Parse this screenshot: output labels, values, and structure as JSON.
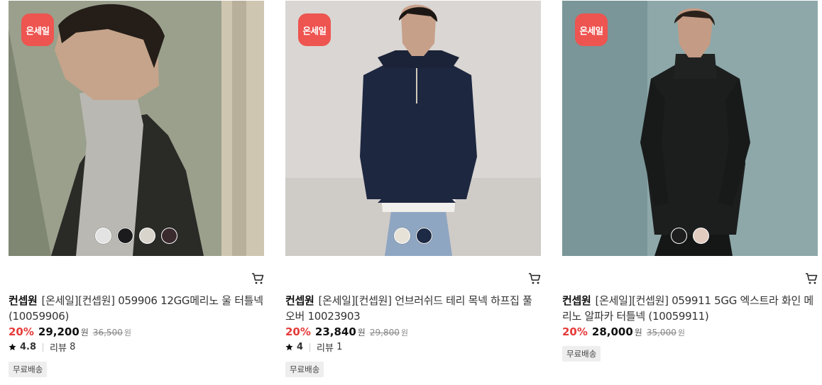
{
  "products": [
    {
      "badge": "온세일",
      "brand": "컨셉원",
      "name": "[온세일][컨셉원] 059906 12GG메리노 울 터틀넥 (10059906)",
      "discount": "20%",
      "price": "29,200",
      "price_unit": "원",
      "original_price": "36,500",
      "original_unit": "원",
      "rating": "4.8",
      "review_label": "리뷰",
      "review_count": "8",
      "tag": "무료배송",
      "swatch_colors": [
        "#e3e3e3",
        "#1b1b1d",
        "#d8d3cb",
        "#3a2a2e"
      ]
    },
    {
      "badge": "온세일",
      "brand": "컨셉원",
      "name": "[온세일][컨셉원] 언브러쉬드 테리 목넥 하프집 풀오버 10023903",
      "discount": "20%",
      "price": "23,840",
      "price_unit": "원",
      "original_price": "29,800",
      "original_unit": "원",
      "rating": "4",
      "review_label": "리뷰",
      "review_count": "1",
      "tag": "무료배송",
      "swatch_colors": [
        "#e6e2d8",
        "#1d2a45"
      ]
    },
    {
      "badge": "온세일",
      "brand": "컨셉원",
      "name": "[온세일][컨셉원] 059911 5GG 엑스트라 화인 메리노 알파카 터틀넥 (10059911)",
      "discount": "20%",
      "price": "28,000",
      "price_unit": "원",
      "original_price": "35,000",
      "original_unit": "원",
      "tag": "무료배송",
      "swatch_colors": [
        "#1e1e1e",
        "#e2cbbf"
      ]
    }
  ]
}
